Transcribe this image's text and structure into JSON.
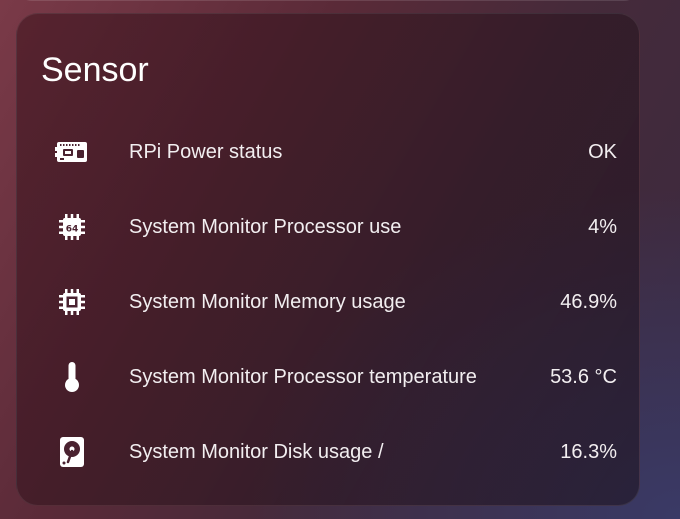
{
  "card": {
    "title": "Sensor",
    "rows": [
      {
        "icon": "raspberry-pi-board-icon",
        "label": "RPi Power status",
        "value": "OK"
      },
      {
        "icon": "cpu-64-bit-icon",
        "label": "System Monitor Processor use",
        "value": "4%"
      },
      {
        "icon": "memory-chip-icon",
        "label": "System Monitor Memory usage",
        "value": "46.9%"
      },
      {
        "icon": "thermometer-icon",
        "label": "System Monitor Processor temperature",
        "value": "53.6 °C"
      },
      {
        "icon": "harddisk-icon",
        "label": "System Monitor Disk usage /",
        "value": "16.3%"
      }
    ]
  },
  "colors": {
    "text": "#f2eef0",
    "title": "#ffffff"
  }
}
